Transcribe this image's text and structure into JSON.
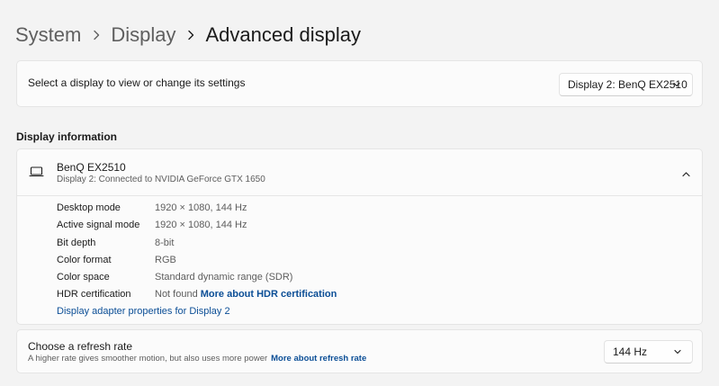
{
  "breadcrumb": {
    "items": [
      "System",
      "Display",
      "Advanced display"
    ]
  },
  "select_display": {
    "label": "Select a display to view or change its settings",
    "dropdown_value": "Display 2: BenQ EX2510"
  },
  "display_information": {
    "section_title": "Display information",
    "display_name": "BenQ EX2510",
    "display_subtitle": "Display 2: Connected to NVIDIA GeForce GTX 1650",
    "rows": [
      {
        "key": "Desktop mode",
        "value": "1920 × 1080, 144 Hz"
      },
      {
        "key": "Active signal mode",
        "value": "1920 × 1080, 144 Hz"
      },
      {
        "key": "Bit depth",
        "value": "8-bit"
      },
      {
        "key": "Color format",
        "value": "RGB"
      },
      {
        "key": "Color space",
        "value": "Standard dynamic range (SDR)"
      },
      {
        "key": "HDR certification",
        "value": "Not found",
        "link": "More about HDR certification"
      }
    ],
    "adapter_link": "Display adapter properties for Display 2"
  },
  "refresh_rate": {
    "title": "Choose a refresh rate",
    "subtitle": "A higher rate gives smoother motion, but also uses more power",
    "link": "More about refresh rate",
    "dropdown_value": "144 Hz"
  },
  "icons": {
    "breadcrumb_separator": "chevron-right-icon",
    "dropdown": "chevron-down-icon",
    "collapse": "chevron-up-icon",
    "monitor": "monitor-icon"
  },
  "colors": {
    "background": "#f3f3f3",
    "card": "#fbfbfb",
    "link": "#0b4e96",
    "secondary_text": "#5d5d5d"
  }
}
